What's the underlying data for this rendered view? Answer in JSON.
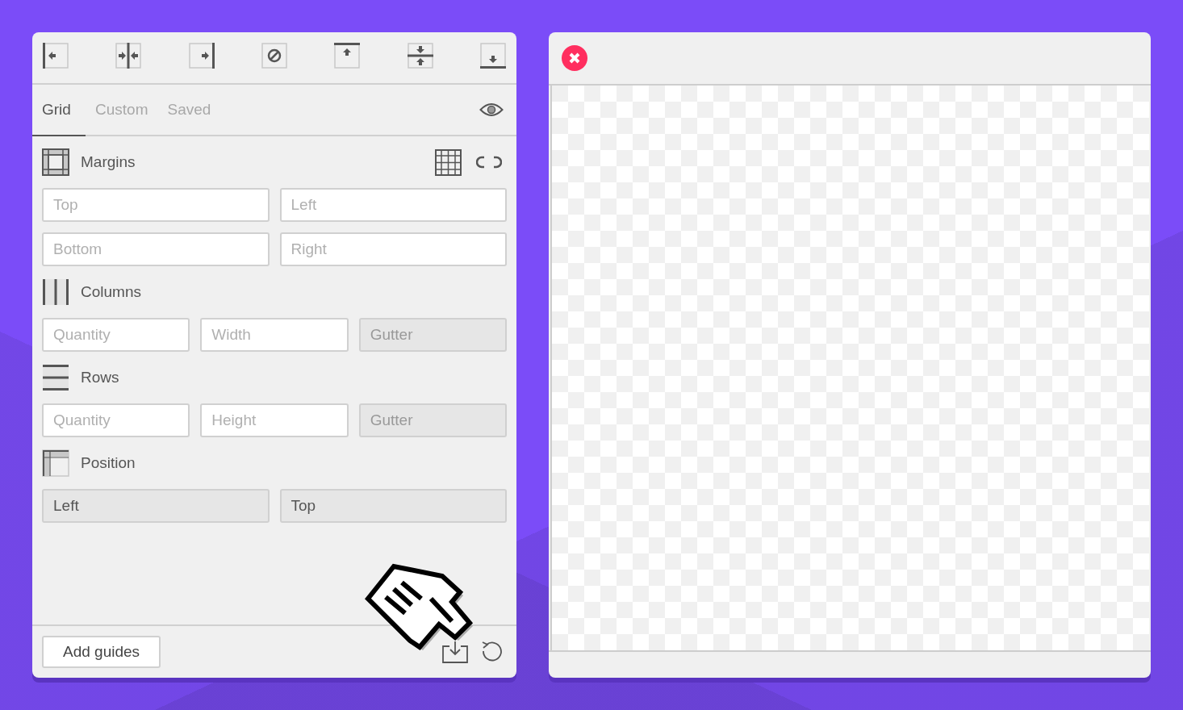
{
  "toolbar": [
    {
      "kind": "align-left"
    },
    {
      "kind": "align-center"
    },
    {
      "kind": "align-right"
    },
    {
      "kind": "clear"
    },
    {
      "kind": "align-top"
    },
    {
      "kind": "align-middle"
    },
    {
      "kind": "align-bottom"
    }
  ],
  "tabs": [
    {
      "label": "Grid",
      "selected": true
    },
    {
      "label": "Custom",
      "selected": false
    },
    {
      "label": "Saved",
      "selected": false
    }
  ],
  "sections": [
    {
      "kind": "margins",
      "title": "Margins",
      "fields": [
        {
          "placeholder": "Top",
          "disabled": false
        },
        {
          "placeholder": "Left",
          "disabled": false
        },
        {
          "placeholder": "Bottom",
          "disabled": false
        },
        {
          "placeholder": "Right",
          "disabled": false
        }
      ]
    },
    {
      "kind": "columns",
      "title": "Columns",
      "fields": [
        {
          "placeholder": "Quantity",
          "disabled": false
        },
        {
          "placeholder": "Width",
          "disabled": false
        },
        {
          "placeholder": "Gutter",
          "disabled": true
        }
      ]
    },
    {
      "kind": "rows",
      "title": "Rows",
      "fields": [
        {
          "placeholder": "Quantity",
          "disabled": false
        },
        {
          "placeholder": "Height",
          "disabled": false
        },
        {
          "placeholder": "Gutter",
          "disabled": true
        }
      ]
    },
    {
      "kind": "position",
      "title": "Position",
      "fields": [
        {
          "value": "Left",
          "disabled": true
        },
        {
          "value": "Top",
          "disabled": true
        }
      ]
    }
  ],
  "footer": {
    "button": "Add guides"
  }
}
